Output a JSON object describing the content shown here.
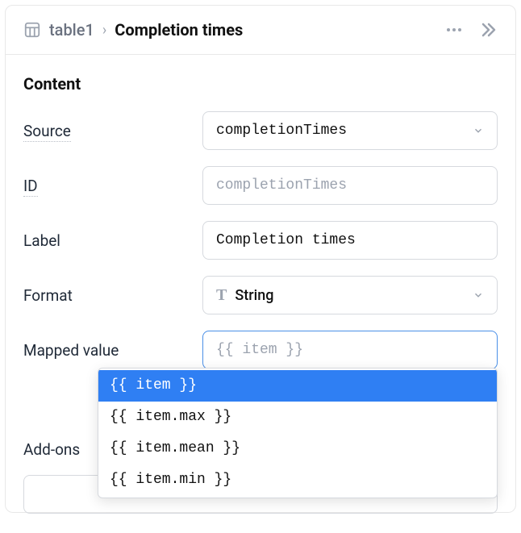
{
  "header": {
    "breadcrumb_parent": "table1",
    "breadcrumb_current": "Completion times"
  },
  "section": {
    "heading": "Content"
  },
  "fields": {
    "source": {
      "label": "Source",
      "value": "completionTimes"
    },
    "id": {
      "label": "ID",
      "placeholder": "completionTimes"
    },
    "label": {
      "label": "Label",
      "value": "Completion times"
    },
    "format": {
      "label": "Format",
      "value": "String"
    },
    "mapped": {
      "label": "Mapped value",
      "placeholder": "{{ item }}"
    },
    "addons": {
      "label": "Add-ons"
    }
  },
  "dropdown": {
    "items": [
      "{{ item }}",
      "{{ item.max }}",
      "{{ item.mean }}",
      "{{ item.min }}"
    ],
    "selected_index": 0
  }
}
